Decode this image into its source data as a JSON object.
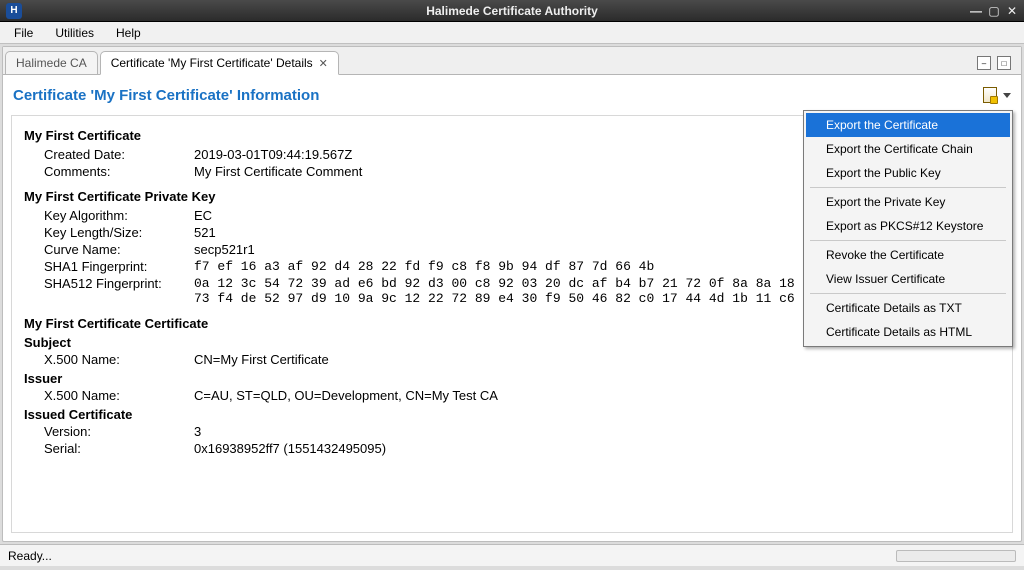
{
  "window": {
    "title": "Halimede Certificate Authority",
    "app_icon_letter": "H"
  },
  "menubar": [
    "File",
    "Utilities",
    "Help"
  ],
  "tabs": [
    {
      "label": "Halimede CA",
      "active": false
    },
    {
      "label": "Certificate 'My First Certificate' Details",
      "active": true
    }
  ],
  "page_title": "Certificate 'My First Certificate' Information",
  "context_menu": {
    "items": [
      {
        "label": "Export the Certificate",
        "selected": true
      },
      {
        "label": "Export the Certificate Chain"
      },
      {
        "label": "Export the Public Key"
      },
      {
        "sep": true
      },
      {
        "label": "Export the Private Key"
      },
      {
        "label": "Export as PKCS#12 Keystore"
      },
      {
        "sep": true
      },
      {
        "label": "Revoke the Certificate"
      },
      {
        "label": "View Issuer Certificate"
      },
      {
        "sep": true
      },
      {
        "label": "Certificate Details as TXT"
      },
      {
        "label": "Certificate Details as HTML"
      }
    ]
  },
  "cert": {
    "name": "My First Certificate",
    "created_label": "Created Date:",
    "created": "2019-03-01T09:44:19.567Z",
    "comments_label": "Comments:",
    "comments": "My First Certificate Comment",
    "pk_section": "My First Certificate Private Key",
    "key_algo_label": "Key Algorithm:",
    "key_algo": "EC",
    "key_len_label": "Key Length/Size:",
    "key_len": "521",
    "curve_label": "Curve Name:",
    "curve": "secp521r1",
    "sha1_label": "SHA1 Fingerprint:",
    "sha1": "f7 ef 16 a3 af 92 d4 28 22 fd f9 c8 f8 9b 94 df 87 7d 66 4b",
    "sha512_label": "SHA512 Fingerprint:",
    "sha512": "0a 12 3c 54 72 39 ad e6 bd 92 d3 00 c8 92 03 20 dc af b4 b7 21 72 0f 8a 8a 18 71\n73 f4 de 52 97 d9 10 9a 9c 12 22 72 89 e4 30 f9 50 46 82 c0 17 44 4d 1b 11 c6 4c",
    "cert_section": "My First Certificate Certificate",
    "subject_label": "Subject",
    "x500_label": "X.500 Name:",
    "subject_x500": "CN=My First Certificate",
    "issuer_label": "Issuer",
    "issuer_x500": "C=AU, ST=QLD, OU=Development, CN=My Test CA",
    "issued_cert_label": "Issued Certificate",
    "version_label": "Version:",
    "version": "3",
    "serial_label": "Serial:",
    "serial": "0x16938952ff7 (1551432495095)"
  },
  "status": "Ready..."
}
